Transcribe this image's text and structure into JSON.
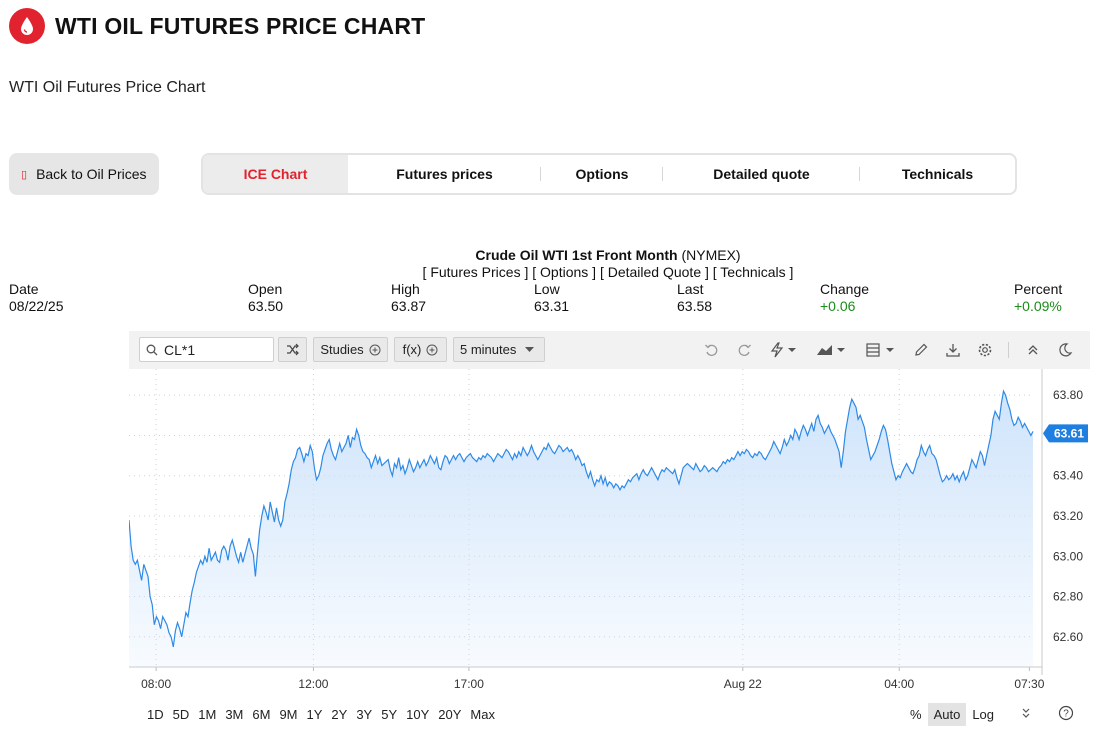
{
  "page": {
    "title": "WTI OIL FUTURES PRICE CHART",
    "subtitle": "WTI Oil Futures Price Chart",
    "logo_icon": "oil-drop-icon",
    "accent_color": "#e0232e"
  },
  "nav": {
    "back_label": "Back to Oil Prices",
    "tabs": [
      {
        "label": "ICE Chart",
        "active": true
      },
      {
        "label": "Futures prices",
        "active": false
      },
      {
        "label": "Options",
        "active": false
      },
      {
        "label": "Detailed quote",
        "active": false
      },
      {
        "label": "Technicals",
        "active": false
      }
    ]
  },
  "contract": {
    "name": "Crude Oil WTI 1st Front Month",
    "exchange": "(NYMEX)",
    "links": "[ Futures Prices ] [ Options ] [ Detailed Quote ] [ Technicals ]"
  },
  "quote": {
    "date_label": "Date",
    "date": "08/22/25",
    "open_label": "Open",
    "open": "63.50",
    "high_label": "High",
    "high": "63.87",
    "low_label": "Low",
    "low": "63.31",
    "last_label": "Last",
    "last": "63.58",
    "change_label": "Change",
    "change": "+0.06",
    "percent_label": "Percent",
    "percent": "+0.09%",
    "positive_color": "#1a8d1a"
  },
  "toolbar": {
    "symbol": "CL*1",
    "studies_label": "Studies",
    "fx_label": "f(x)",
    "interval_label": "5 minutes",
    "icons": [
      "undo-icon",
      "redo-icon",
      "lightning-icon",
      "chart-type-icon",
      "layout-icon",
      "pencil-icon",
      "download-icon",
      "settings-icon",
      "collapse-icon",
      "dark-mode-icon"
    ]
  },
  "chart_data": {
    "type": "area",
    "title": "",
    "xlabel": "",
    "ylabel": "",
    "line_color": "#2e8ae6",
    "fill_color": "#cfe4fb",
    "ylim": [
      62.45,
      63.93
    ],
    "y_ticks": [
      "63.80",
      "63.60",
      "63.40",
      "63.20",
      "63.00",
      "62.80",
      "62.60"
    ],
    "x_ticks": [
      "08:00",
      "12:00",
      "17:00",
      "Aug 22",
      "04:00",
      "07:30"
    ],
    "last_value": "63.61",
    "series": [
      {
        "values": [
          63.18,
          63.05,
          62.98,
          62.96,
          62.98,
          62.93,
          62.88,
          62.96,
          62.93,
          62.9,
          62.8,
          62.76,
          62.66,
          62.7,
          62.68,
          62.64,
          62.7,
          62.68,
          62.66,
          62.62,
          62.6,
          62.55,
          62.63,
          62.67,
          62.64,
          62.6,
          62.66,
          62.72,
          62.7,
          62.77,
          62.83,
          62.87,
          62.92,
          62.95,
          62.98,
          62.96,
          63.0,
          62.97,
          63.04,
          62.98,
          63.0,
          63.02,
          62.98,
          62.97,
          63.03,
          63.05,
          63.03,
          62.98,
          63.05,
          63.08,
          63.04,
          63.0,
          62.97,
          63.02,
          62.97,
          63.01,
          63.05,
          63.09,
          63.04,
          63.01,
          62.9,
          63.02,
          63.13,
          63.2,
          63.25,
          63.22,
          63.18,
          63.27,
          63.22,
          63.17,
          63.24,
          63.18,
          63.15,
          63.18,
          63.27,
          63.31,
          63.36,
          63.43,
          63.47,
          63.49,
          63.53,
          63.54,
          63.51,
          63.47,
          63.51,
          63.5,
          63.55,
          63.52,
          63.44,
          63.38,
          63.4,
          63.44,
          63.5,
          63.53,
          63.56,
          63.58,
          63.53,
          63.5,
          63.48,
          63.52,
          63.56,
          63.52,
          63.54,
          63.56,
          63.6,
          63.54,
          63.59,
          63.58,
          63.63,
          63.6,
          63.55,
          63.52,
          63.51,
          63.49,
          63.48,
          63.44,
          63.47,
          63.5,
          63.46,
          63.49,
          63.45,
          63.46,
          63.47,
          63.48,
          63.43,
          63.4,
          63.46,
          63.44,
          63.49,
          63.43,
          63.45,
          63.41,
          63.44,
          63.48,
          63.45,
          63.42,
          63.44,
          63.47,
          63.44,
          63.46,
          63.48,
          63.45,
          63.47,
          63.5,
          63.48,
          63.46,
          63.49,
          63.44,
          63.43,
          63.47,
          63.5,
          63.49,
          63.46,
          63.48,
          63.5,
          63.48,
          63.5,
          63.51,
          63.49,
          63.47,
          63.49,
          63.5,
          63.51,
          63.49,
          63.48,
          63.47,
          63.49,
          63.48,
          63.5,
          63.49,
          63.51,
          63.5,
          63.49,
          63.47,
          63.49,
          63.51,
          63.5,
          63.49,
          63.51,
          63.53,
          63.52,
          63.5,
          63.48,
          63.51,
          63.49,
          63.52,
          63.5,
          63.54,
          63.52,
          63.5,
          63.52,
          63.55,
          63.52,
          63.5,
          63.48,
          63.5,
          63.52,
          63.54,
          63.53,
          63.56,
          63.54,
          63.52,
          63.51,
          63.53,
          63.55,
          63.54,
          63.52,
          63.53,
          63.54,
          63.52,
          63.53,
          63.51,
          63.48,
          63.5,
          63.48,
          63.45,
          63.46,
          63.42,
          63.39,
          63.42,
          63.38,
          63.35,
          63.38,
          63.37,
          63.4,
          63.36,
          63.39,
          63.35,
          63.37,
          63.36,
          63.34,
          63.36,
          63.35,
          63.33,
          63.35,
          63.34,
          63.36,
          63.38,
          63.37,
          63.39,
          63.4,
          63.41,
          63.38,
          63.41,
          63.43,
          63.41,
          63.4,
          63.42,
          63.44,
          63.42,
          63.4,
          63.38,
          63.41,
          63.43,
          63.42,
          63.44,
          63.43,
          63.42,
          63.41,
          63.43,
          63.39,
          63.36,
          63.4,
          63.44,
          63.45,
          63.46,
          63.45,
          63.44,
          63.43,
          63.46,
          63.44,
          63.42,
          63.43,
          63.45,
          63.44,
          63.42,
          63.43,
          63.44,
          63.43,
          63.42,
          63.44,
          63.45,
          63.47,
          63.46,
          63.48,
          63.47,
          63.49,
          63.48,
          63.5,
          63.52,
          63.5,
          63.52,
          63.51,
          63.53,
          63.52,
          63.5,
          63.49,
          63.51,
          63.5,
          63.52,
          63.51,
          63.49,
          63.48,
          63.5,
          63.52,
          63.54,
          63.57,
          63.55,
          63.53,
          63.51,
          63.54,
          63.58,
          63.55,
          63.57,
          63.6,
          63.58,
          63.63,
          63.61,
          63.58,
          63.62,
          63.65,
          63.63,
          63.6,
          63.63,
          63.66,
          63.62,
          63.68,
          63.7,
          63.66,
          63.64,
          63.61,
          63.63,
          63.65,
          63.62,
          63.6,
          63.58,
          63.55,
          63.52,
          63.44,
          63.52,
          63.62,
          63.68,
          63.74,
          63.78,
          63.76,
          63.74,
          63.68,
          63.7,
          63.67,
          63.64,
          63.58,
          63.53,
          63.48,
          63.5,
          63.52,
          63.55,
          63.58,
          63.62,
          63.65,
          63.63,
          63.58,
          63.52,
          63.46,
          63.42,
          63.38,
          63.4,
          63.39,
          63.42,
          63.44,
          63.46,
          63.44,
          63.42,
          63.41,
          63.44,
          63.48,
          63.5,
          63.55,
          63.52,
          63.5,
          63.53,
          63.55,
          63.51,
          63.5,
          63.48,
          63.44,
          63.4,
          63.37,
          63.38,
          63.4,
          63.38,
          63.39,
          63.41,
          63.38,
          63.4,
          63.37,
          63.4,
          63.42,
          63.38,
          63.4,
          63.44,
          63.48,
          63.46,
          63.44,
          63.48,
          63.52,
          63.5,
          63.45,
          63.5,
          63.55,
          63.6,
          63.68,
          63.72,
          63.7,
          63.68,
          63.76,
          63.82,
          63.8,
          63.76,
          63.73,
          63.68,
          63.65,
          63.66,
          63.69,
          63.67,
          63.64,
          63.66,
          63.64,
          63.62,
          63.6,
          63.62
        ]
      }
    ]
  },
  "range": {
    "buttons": [
      "1D",
      "5D",
      "1M",
      "3M",
      "6M",
      "9M",
      "1Y",
      "2Y",
      "3Y",
      "5Y",
      "10Y",
      "20Y",
      "Max"
    ],
    "percent_label": "%",
    "auto_label": "Auto",
    "log_label": "Log"
  }
}
